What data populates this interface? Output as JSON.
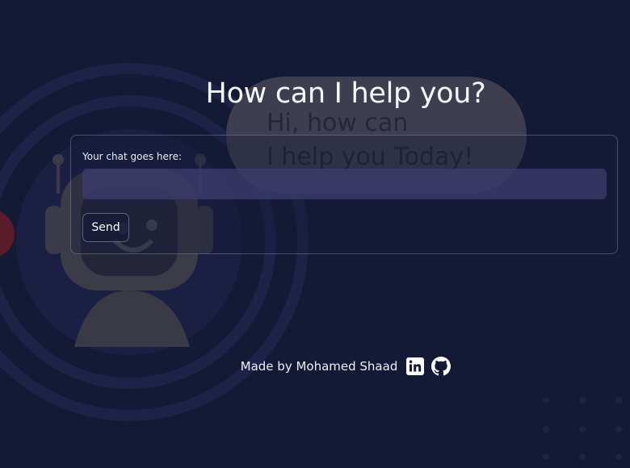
{
  "page": {
    "title": "How can I help you?"
  },
  "background": {
    "bubble_line_1": "Hi, how can",
    "bubble_line_2": "I help you Today!"
  },
  "chat": {
    "label": "Your chat goes here:",
    "input_value": "",
    "input_placeholder": "",
    "send_label": "Send"
  },
  "footer": {
    "credit": "Made by Mohamed Shaad",
    "links": [
      {
        "icon": "linkedin-icon"
      },
      {
        "icon": "github-icon"
      }
    ]
  },
  "colors": {
    "background": "#141935",
    "input_fill": "#3e3c6e",
    "text": "#ffffff"
  }
}
